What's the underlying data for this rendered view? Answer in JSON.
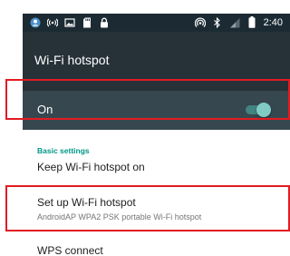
{
  "status_bar": {
    "time": "2:40",
    "left_icons": [
      "account-icon",
      "hotspot-broadcast-icon",
      "image-icon",
      "sd-card-icon",
      "lock-icon"
    ],
    "right_icons": [
      "hotspot-icon",
      "bluetooth-icon",
      "signal-icon",
      "battery-icon"
    ]
  },
  "app_bar": {
    "title": "Wi-Fi hotspot"
  },
  "switch_bar": {
    "label": "On",
    "enabled": true
  },
  "section": {
    "header": "Basic settings"
  },
  "preferences": [
    {
      "title": "Keep Wi-Fi hotspot on",
      "summary": ""
    },
    {
      "title": "Set up Wi-Fi hotspot",
      "summary": "AndroidAP WPA2 PSK portable Wi-Fi hotspot"
    },
    {
      "title": "WPS connect",
      "summary": ""
    }
  ],
  "colors": {
    "status_bar": "#1c2b33",
    "app_bar": "#263238",
    "switch_bar": "#37474f",
    "accent": "#009688",
    "highlight": "#e11b22"
  }
}
